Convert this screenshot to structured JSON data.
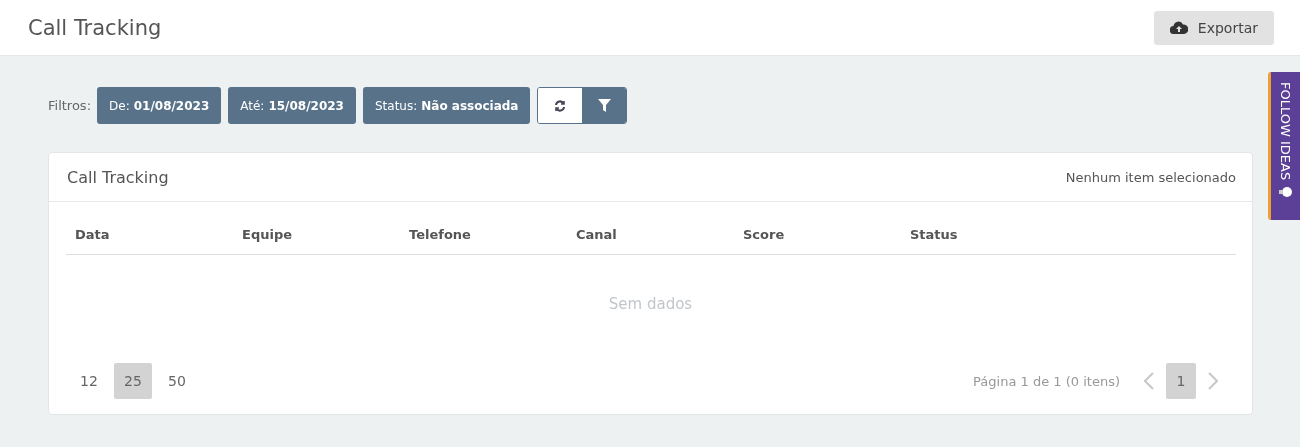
{
  "header": {
    "title": "Call Tracking",
    "export_button": "Exportar"
  },
  "filters": {
    "label": "Filtros:",
    "chips": [
      {
        "label": "De:",
        "value": "01/08/2023"
      },
      {
        "label": "Até:",
        "value": "15/08/2023"
      },
      {
        "label": "Status:",
        "value": "Não associada"
      }
    ]
  },
  "card": {
    "title": "Call Tracking",
    "selection": "Nenhum item selecionado",
    "columns": [
      "Data",
      "Equipe",
      "Telefone",
      "Canal",
      "Score",
      "Status"
    ],
    "empty": "Sem dados",
    "page_sizes": [
      {
        "label": "12",
        "selected": false
      },
      {
        "label": "25",
        "selected": true
      },
      {
        "label": "50",
        "selected": false
      }
    ],
    "page_info": "Página 1 de 1 (0 itens)",
    "pages": [
      {
        "label": "1",
        "selected": true
      }
    ]
  },
  "side_tab": {
    "label": "FOLLOW IDEAS"
  }
}
